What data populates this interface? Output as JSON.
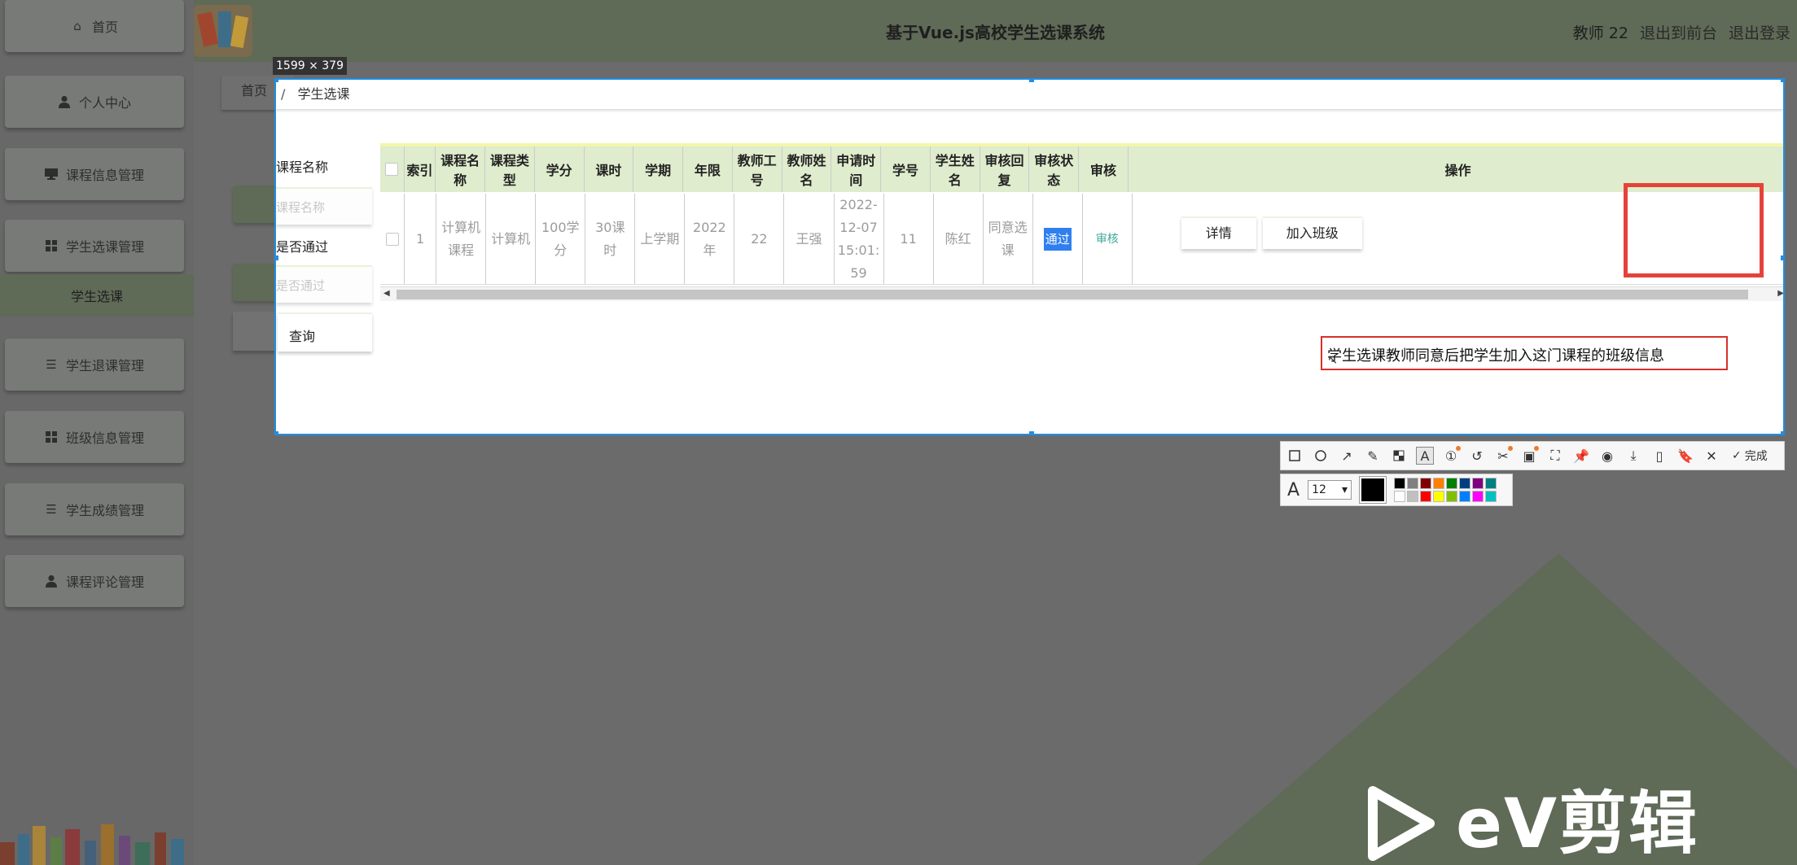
{
  "header": {
    "title": "基于Vue.js高校学生选课系统",
    "user": "教师 22",
    "back_front": "退出到前台",
    "logout": "退出登录"
  },
  "sidebar": {
    "items": [
      {
        "label": "首页",
        "icon": "home-icon"
      },
      {
        "label": "个人中心",
        "icon": "user-icon"
      },
      {
        "label": "课程信息管理",
        "icon": "monitor-icon"
      },
      {
        "label": "学生选课管理",
        "icon": "grid-icon"
      },
      {
        "label": "学生退课管理",
        "icon": "list-icon"
      },
      {
        "label": "班级信息管理",
        "icon": "grid-icon"
      },
      {
        "label": "学生成绩管理",
        "icon": "list-icon"
      },
      {
        "label": "课程评论管理",
        "icon": "user-icon"
      }
    ],
    "active_sub": "学生选课"
  },
  "capture": {
    "size_label": "1599 × 379",
    "breadcrumb_home": "首页",
    "breadcrumb_sep": "/",
    "breadcrumb_current": "学生选课"
  },
  "filters": {
    "course_label": "课程名称",
    "course_placeholder": "课程名称",
    "passed_label": "是否通过",
    "passed_placeholder": "是否通过",
    "query_btn": "查询"
  },
  "table": {
    "headers": [
      "索引",
      "课程名称",
      "课程类型",
      "学分",
      "课时",
      "学期",
      "年限",
      "教师工号",
      "教师姓名",
      "申请时间",
      "学号",
      "学生姓名",
      "审核回复",
      "审核状态",
      "审核",
      "操作"
    ],
    "row": {
      "index": "1",
      "course_name": "计算机课程",
      "course_type": "计算机",
      "credit": "100学分",
      "hours": "30课时",
      "term": "上学期",
      "year": "2022年",
      "teacher_id": "22",
      "teacher_name": "王强",
      "apply_time": "2022-12-07 15:01:59",
      "student_id": "11",
      "student_name": "陈红",
      "reply": "同意选课",
      "status": "通过",
      "audit": "审核",
      "btn_detail": "详情",
      "btn_join": "加入班级"
    }
  },
  "annotation": {
    "text": "学生选课教师同意后把学生加入这门课程的班级信息"
  },
  "toolbar": {
    "finish": "完成",
    "font_size": "12",
    "palette": [
      "#000000",
      "#808080",
      "#800000",
      "#ff8000",
      "#008000",
      "#004080",
      "#800080",
      "#008080",
      "#ffffff",
      "#c0c0c0",
      "#ff0000",
      "#ffff00",
      "#80c000",
      "#0080ff",
      "#ff00ff",
      "#00c0c0"
    ],
    "current_color": "#000000"
  },
  "watermark": {
    "text": "eV剪辑"
  },
  "colors": {
    "accent_green": "#dfeccd",
    "selection_blue": "#1f8fe5",
    "annotation_red": "#e5433a"
  }
}
